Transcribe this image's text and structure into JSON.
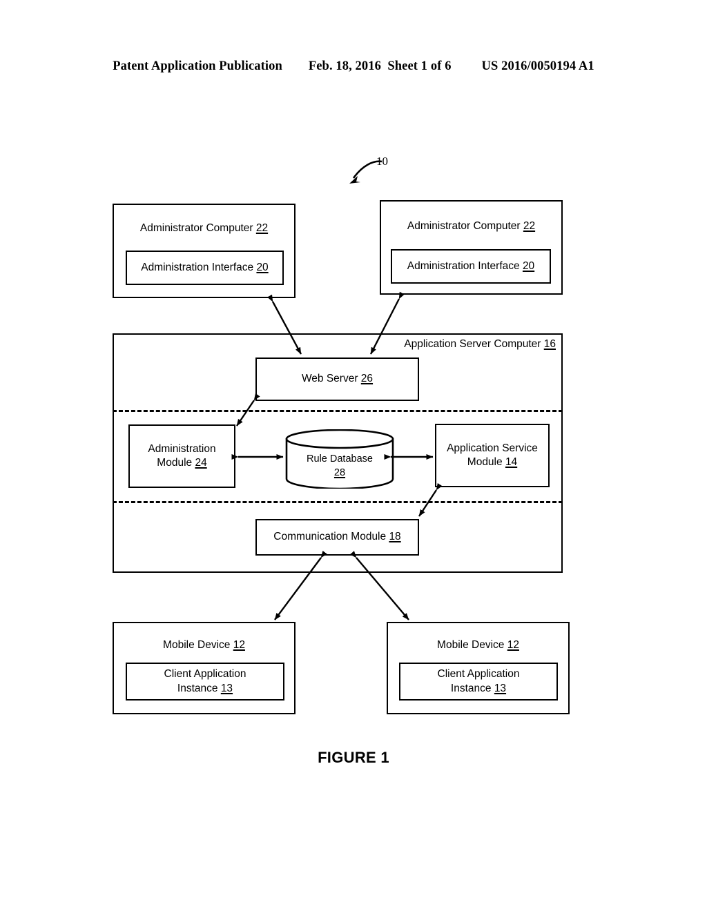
{
  "header": {
    "left": "Patent Application Publication",
    "center": "Feb. 18, 2016  Sheet 1 of 6",
    "right": "US 2016/0050194 A1"
  },
  "figure": {
    "caption": "FIGURE 1",
    "system_reference": "10"
  },
  "nodes": {
    "admin_computer_left": {
      "title": "Administrator Computer ",
      "title_ref": "22",
      "interface": "Administration Interface ",
      "interface_ref": "20"
    },
    "admin_computer_right": {
      "title": "Administrator Computer ",
      "title_ref": "22",
      "interface": "Administration Interface ",
      "interface_ref": "20"
    },
    "application_server": {
      "title": "Application Server Computer ",
      "title_ref": "16"
    },
    "web_server": {
      "label": "Web Server ",
      "ref": "26"
    },
    "administration_module": {
      "line1": "Administration",
      "line2": "Module ",
      "ref": "24"
    },
    "rule_database": {
      "line1": "Rule Database",
      "ref": "28"
    },
    "application_service_module": {
      "line1": "Application Service",
      "line2": "Module ",
      "ref": "14"
    },
    "communication_module": {
      "label": "Communication Module ",
      "ref": "18"
    },
    "mobile_device_left": {
      "title": "Mobile Device ",
      "title_ref": "12",
      "app_line1": "Client Application",
      "app_line2": "Instance ",
      "app_ref": "13"
    },
    "mobile_device_right": {
      "title": "Mobile Device ",
      "title_ref": "12",
      "app_line1": "Client Application",
      "app_line2": "Instance ",
      "app_ref": "13"
    }
  },
  "colors": {
    "line": "#000000",
    "background": "#ffffff"
  }
}
